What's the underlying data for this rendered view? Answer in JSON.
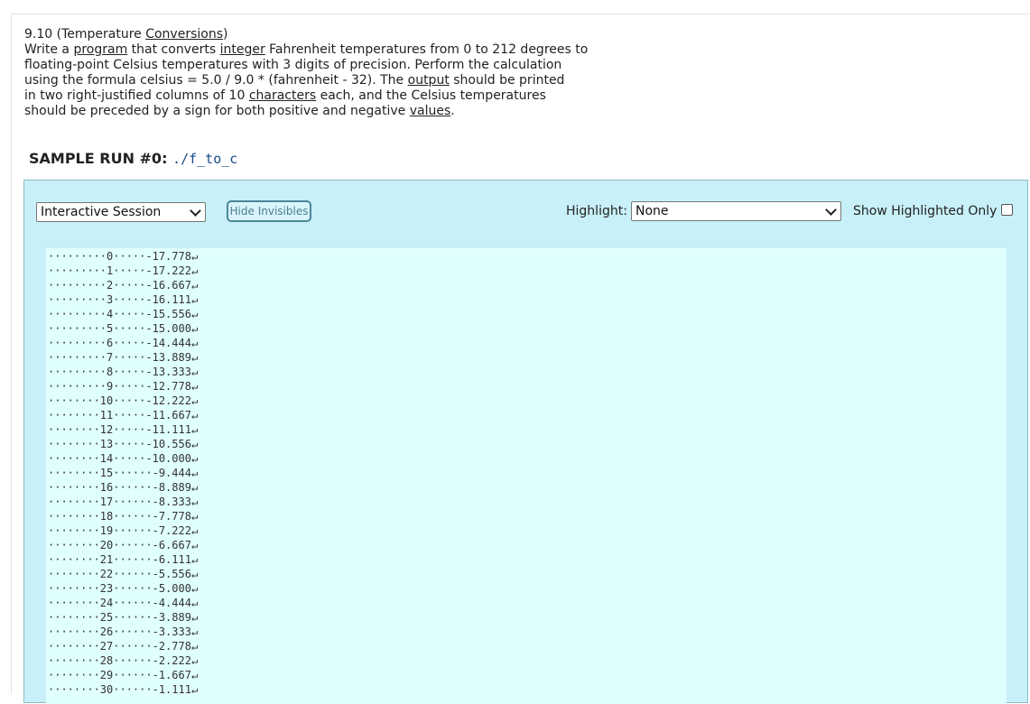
{
  "problem": {
    "title_prefix": "9.10 (Temperature ",
    "title_link": "Conversions",
    "title_suffix": ")",
    "l2_a": "Write a ",
    "l2_link1": "program",
    "l2_b": " that converts ",
    "l2_link2": "integer",
    "l2_c": " Fahrenheit temperatures from 0 to 212 degrees to",
    "l3": "floating-point Celsius temperatures with 3 digits of precision. Perform the calculation",
    "l4_a": "using the formula celsius = 5.0 / 9.0 * (fahrenheit - 32). The ",
    "l4_link": "output",
    "l4_b": " should be printed",
    "l5_a": "in two right-justified columns of 10 ",
    "l5_link": "characters",
    "l5_b": " each, and the Celsius temperatures",
    "l6_a": "should be preceded by a sign for both positive and negative ",
    "l6_link": "values",
    "l6_b": "."
  },
  "sample": {
    "heading": "SAMPLE RUN #0:",
    "command": "./f_to_c"
  },
  "toolbar": {
    "mode_select_value": "Interactive Session",
    "hide_invisibles_label": "Hide Invisibles",
    "highlight_label": "Highlight:",
    "highlight_value": "None",
    "show_highlighted_label": "Show Highlighted Only",
    "show_highlighted_checked": false
  },
  "output_lines": [
    "·········0·····-17.778↵",
    "·········1·····-17.222↵",
    "·········2·····-16.667↵",
    "·········3·····-16.111↵",
    "·········4·····-15.556↵",
    "·········5·····-15.000↵",
    "·········6·····-14.444↵",
    "·········7·····-13.889↵",
    "·········8·····-13.333↵",
    "·········9·····-12.778↵",
    "········10·····-12.222↵",
    "········11·····-11.667↵",
    "········12·····-11.111↵",
    "········13·····-10.556↵",
    "········14·····-10.000↵",
    "········15······-9.444↵",
    "········16······-8.889↵",
    "········17······-8.333↵",
    "········18······-7.778↵",
    "········19······-7.222↵",
    "········20······-6.667↵",
    "········21······-6.111↵",
    "········22······-5.556↵",
    "········23······-5.000↵",
    "········24······-4.444↵",
    "········25······-3.889↵",
    "········26······-3.333↵",
    "········27······-2.778↵",
    "········28······-2.222↵",
    "········29······-1.667↵",
    "········30······-1.111↵"
  ]
}
